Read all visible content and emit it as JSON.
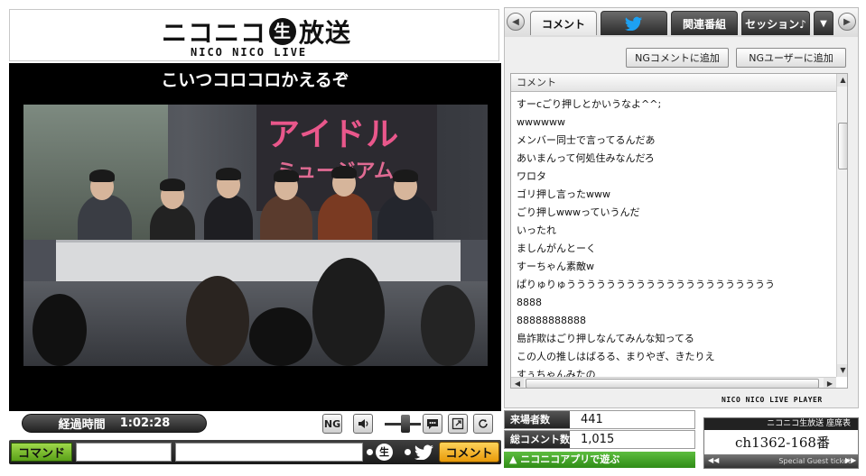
{
  "logo": {
    "main_before": "ニコニコ",
    "main_nama": "生",
    "main_after": "放送",
    "sub": "NICO NICO LIVE"
  },
  "screen_comment": "こいつコロコロかえるぞ",
  "video": {
    "poster_line1": "アイドル",
    "poster_line2": "ミュージアム"
  },
  "controls": {
    "elapsed_label": "経過時間",
    "elapsed_value": "1:02:28",
    "ng_icon_label": "NG"
  },
  "command_bar": {
    "command_label": "コマンド",
    "command_value": "",
    "comment_value": "",
    "nama_label": "生",
    "submit_label": "コメント"
  },
  "tabs": {
    "comment": "コメント",
    "related": "関連番組",
    "session": "セッション♪",
    "dropdown": "▼"
  },
  "ng": {
    "add_comment": "NGコメントに追加",
    "add_user": "NGユーザーに追加"
  },
  "comment_list": {
    "header": "コメント",
    "rows": [
      "すーcごり押しとかいうなよ^^;",
      "wwwwww",
      "メンバー同士で言ってるんだあ",
      "あいまんって何処住みなんだろ",
      "ワロタ",
      "ゴリ押し言ったwww",
      "ごり押しwwwっていうんだ",
      "いったれ",
      "ましんがんとーく",
      "すーちゃん素敵w",
      "ぱりゅりゅううううううううううううううううううううう",
      "8888",
      "88888888888",
      "島詐欺はごり押しなんてみんな知ってる",
      "この人の推しはばるる、まりやぎ、きたりえ",
      "すぅちゃんみたの"
    ]
  },
  "player_brand": "NICO NICO LIVE PLAYER",
  "stats": {
    "visitors_label": "来場者数",
    "visitors_value": "441",
    "comments_label": "総コメント数",
    "comments_value": "1,015",
    "app_link": "▲ ニコニコアプリで遊ぶ"
  },
  "ticket": {
    "head": "ニコニコ生放送 座席表",
    "number": "ch1362-168番",
    "foot": "Special Guest ticket"
  },
  "colors": {
    "command_green": "#5aa018",
    "submit_orange": "#e89a09",
    "twitter_blue": "#1da1f2",
    "poster_pink": "#e9578b"
  }
}
